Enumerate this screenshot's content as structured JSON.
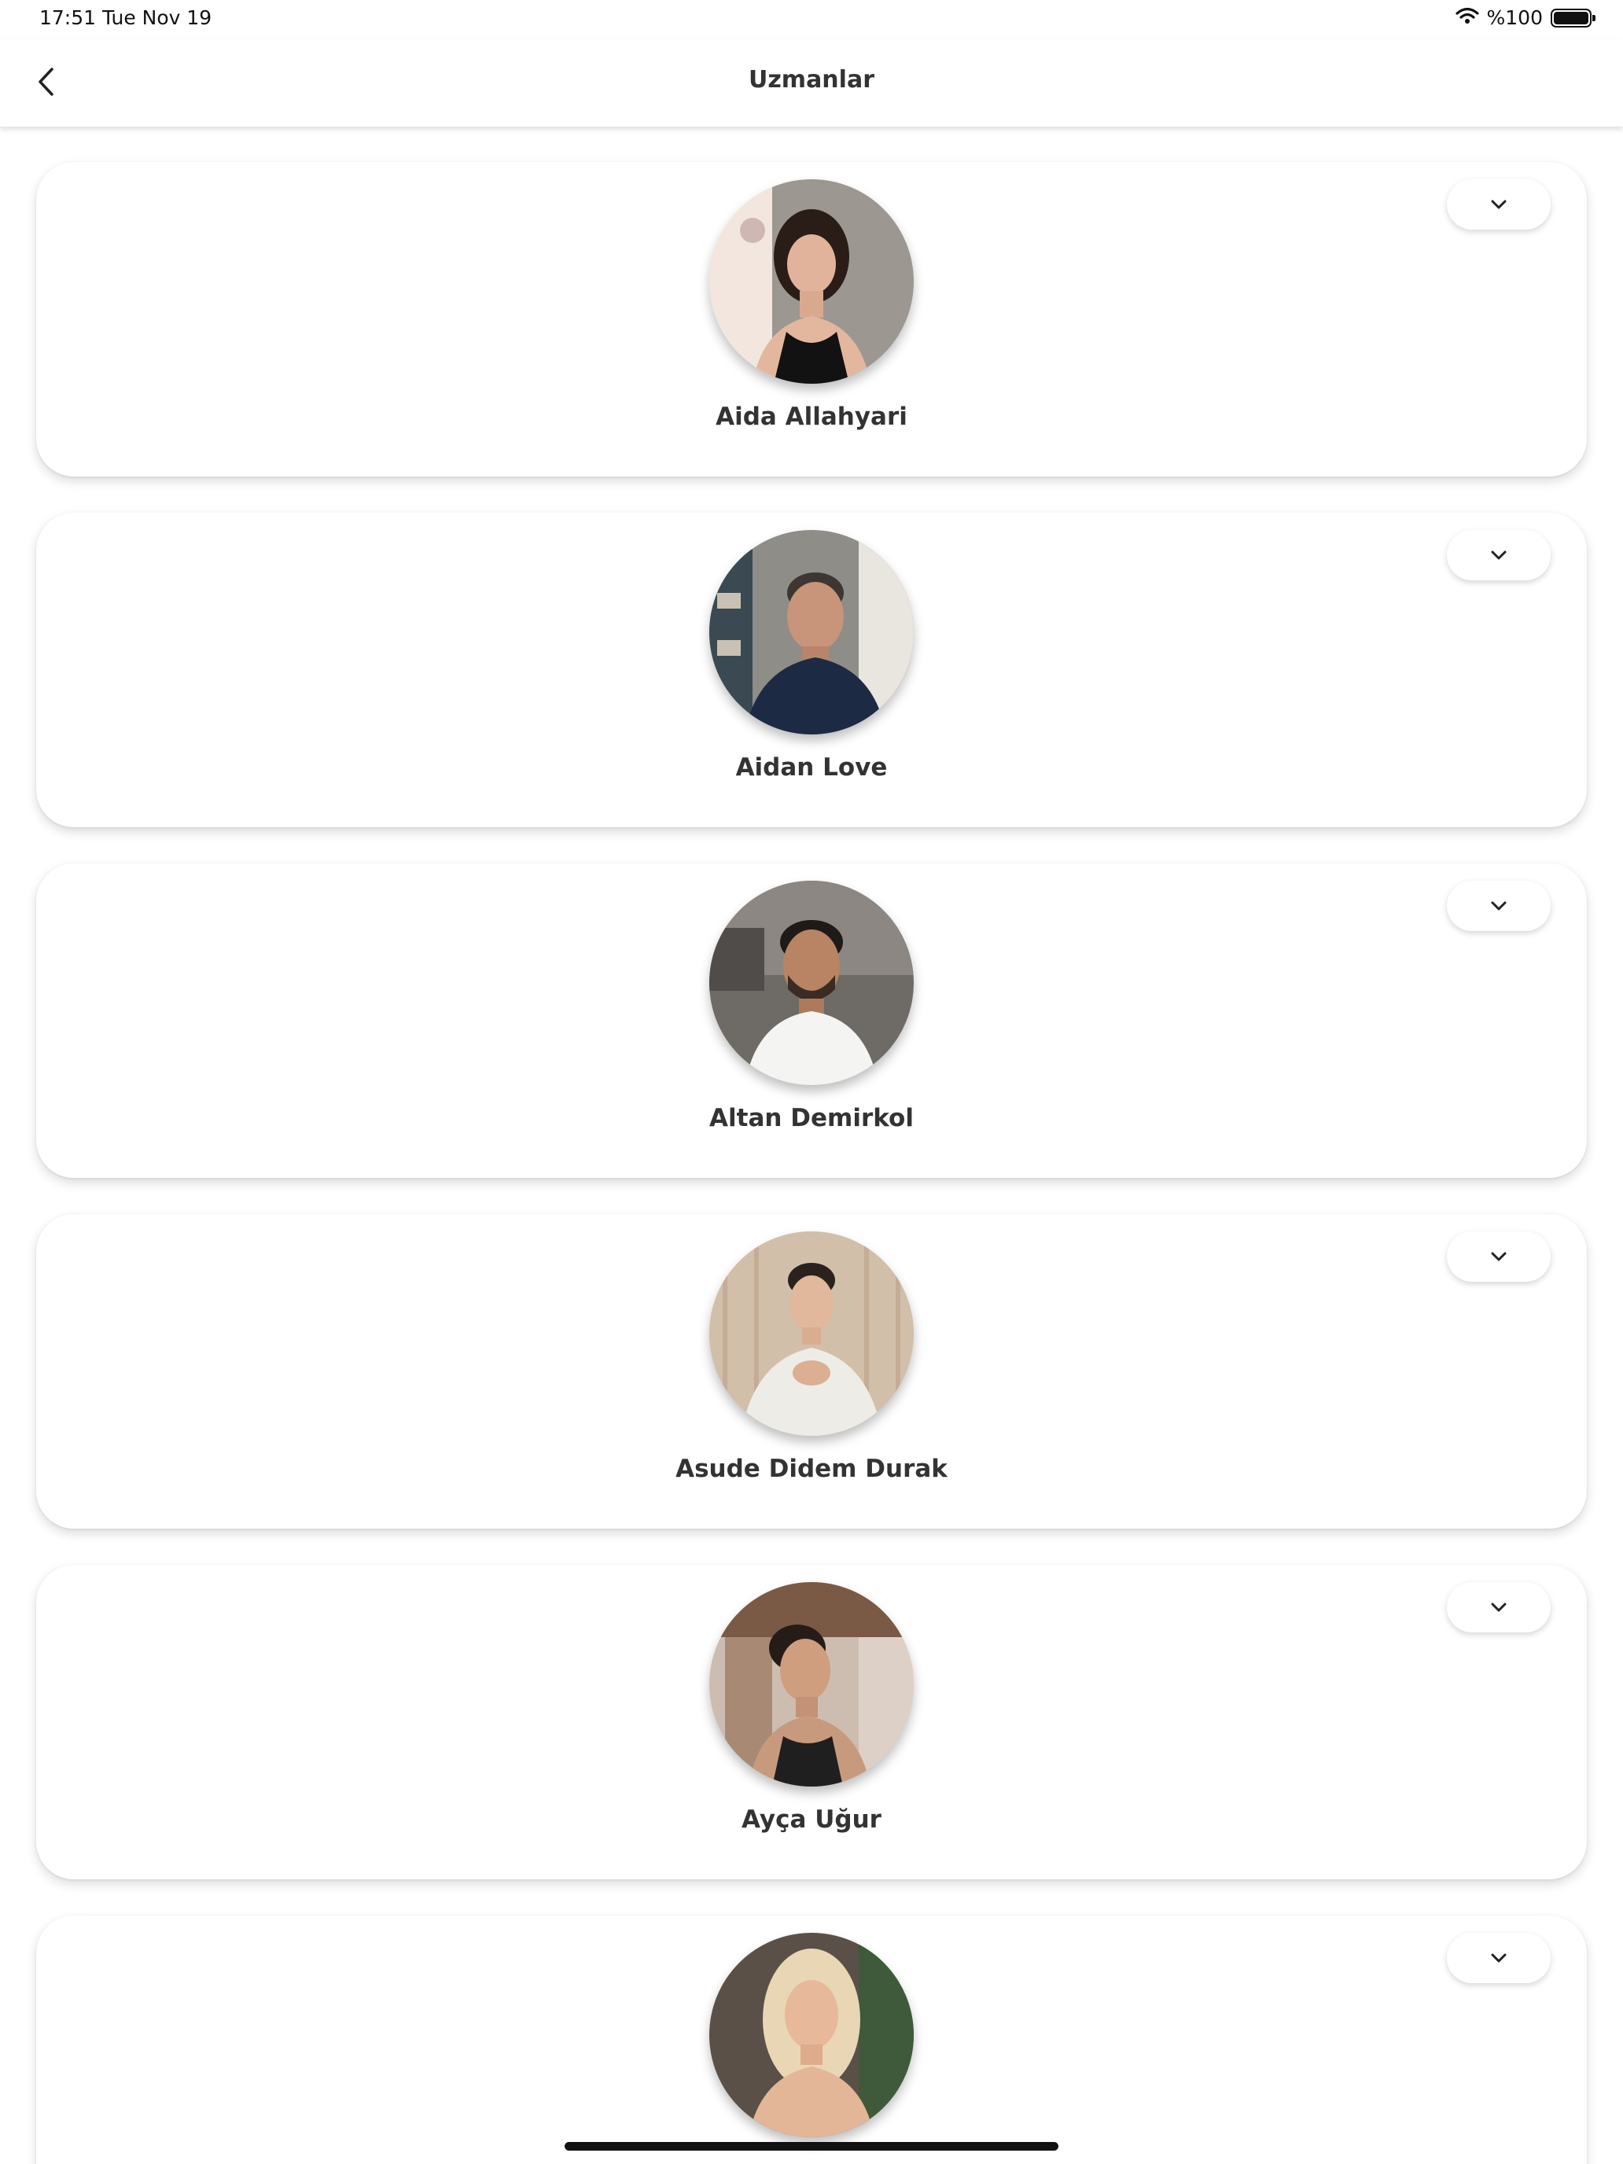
{
  "status_bar": {
    "time": "17:51",
    "date": "Tue Nov 19",
    "battery": "%100",
    "icons": [
      "wifi-icon",
      "battery-icon"
    ]
  },
  "nav": {
    "title": "Uzmanlar",
    "back_icon": "chevron-left-icon"
  },
  "experts": [
    {
      "name": "Aida Allahyari",
      "expand_icon": "chevron-down-icon"
    },
    {
      "name": "Aidan Love",
      "expand_icon": "chevron-down-icon"
    },
    {
      "name": "Altan Demirkol",
      "expand_icon": "chevron-down-icon"
    },
    {
      "name": "Asude Didem Durak",
      "expand_icon": "chevron-down-icon"
    },
    {
      "name": "Ayça Uğur",
      "expand_icon": "chevron-down-icon"
    },
    {
      "name": "",
      "expand_icon": "chevron-down-icon"
    }
  ]
}
